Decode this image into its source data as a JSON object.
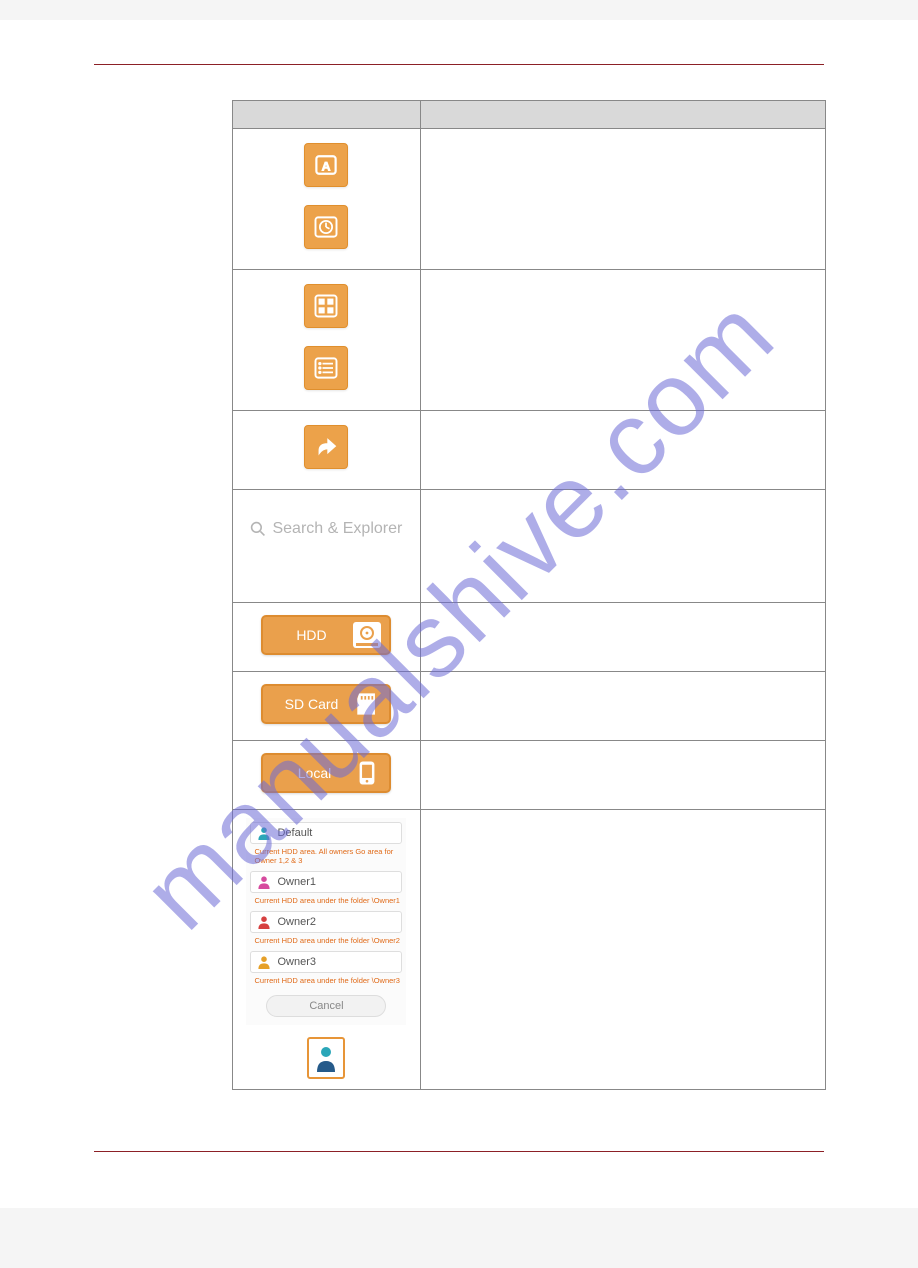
{
  "watermark": "manualshive.com",
  "search_placeholder": "Search & Explorer",
  "buttons": {
    "hdd": "HDD",
    "sdcard": "SD Card",
    "local": "Local"
  },
  "owners": {
    "default": {
      "label": "Default",
      "sub": "Current HDD area. All owners Go area for Owner 1,2 & 3"
    },
    "owner1": {
      "label": "Owner1",
      "sub": "Current HDD area under the folder \\Owner1"
    },
    "owner2": {
      "label": "Owner2",
      "sub": "Current HDD area under the folder \\Owner2"
    },
    "owner3": {
      "label": "Owner3",
      "sub": "Current HDD area under the folder \\Owner3"
    },
    "cancel": "Cancel"
  }
}
